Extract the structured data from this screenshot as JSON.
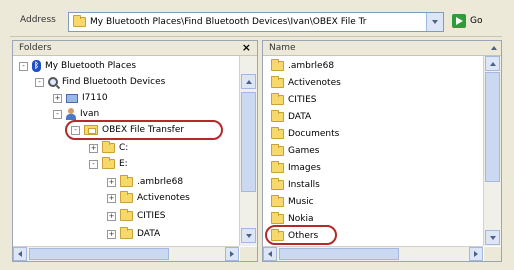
{
  "address_bar": {
    "label": "Address",
    "path": "My Bluetooth Places\\Find Bluetooth Devices\\Ivan\\OBEX File Tr",
    "go_label": "Go"
  },
  "folders_pane": {
    "title": "Folders",
    "close": "×",
    "tree": [
      {
        "label": "My Bluetooth Places",
        "expander": "-",
        "icon": "bluetooth-icon"
      },
      {
        "label": "Find Bluetooth Devices",
        "expander": "-",
        "icon": "search-devices-icon"
      },
      {
        "label": "I7110",
        "expander": "+",
        "icon": "computer-icon"
      },
      {
        "label": "Ivan",
        "expander": "-",
        "icon": "user-icon"
      },
      {
        "label": "OBEX File Transfer",
        "expander": "-",
        "icon": "obex-folder-icon",
        "highlighted": true
      },
      {
        "label": "C:",
        "expander": "+",
        "icon": "folder-icon"
      },
      {
        "label": "E:",
        "expander": "-",
        "icon": "folder-icon"
      },
      {
        "label": ".ambrle68",
        "expander": "+",
        "icon": "folder-icon"
      },
      {
        "label": "Activenotes",
        "expander": "+",
        "icon": "folder-icon"
      },
      {
        "label": "CITIES",
        "expander": "+",
        "icon": "folder-icon"
      },
      {
        "label": "DATA",
        "expander": "+",
        "icon": "folder-icon"
      }
    ]
  },
  "files_pane": {
    "column_name": "Name",
    "items": [
      ".ambrle68",
      "Activenotes",
      "CITIES",
      "DATA",
      "Documents",
      "Games",
      "Images",
      "Installs",
      "Music",
      "Nokia",
      "Others"
    ],
    "highlighted_item": "Others"
  },
  "colors": {
    "highlight": "#b22a2a",
    "folder": "#f6d86b",
    "go_button": "#2e9c3a",
    "bluetooth": "#1f4fc7"
  }
}
